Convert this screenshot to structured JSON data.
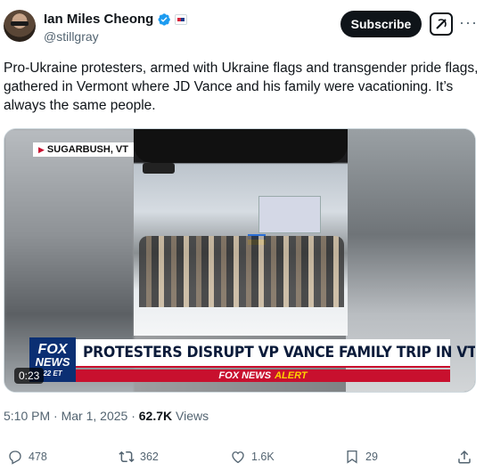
{
  "author": {
    "name": "Ian Miles Cheong",
    "handle": "@stillgray"
  },
  "header": {
    "subscribe_label": "Subscribe",
    "more_label": "···"
  },
  "tweet": {
    "text": "Pro-Ukraine protesters, armed with Ukraine flags and transgender pride flags, gathered in Vermont where JD Vance and his family were vacationing. It’s always the same people."
  },
  "video": {
    "location_label": "SUGARBUSH, VT",
    "logo_line1": "FOX",
    "logo_line2": "NEWS",
    "logo_time": "22 ET",
    "headline": "PROTESTERS DISRUPT VP VANCE FAMILY TRIP IN VT",
    "alert_brand": "FOX NEWS",
    "alert_word": "ALERT",
    "timecode": "0:23",
    "colors": {
      "fox_blue": "#0b2f73",
      "alert_red": "#c8102e",
      "alert_yellow": "#ffd200"
    }
  },
  "meta": {
    "time": "5:10 PM",
    "separator": "·",
    "date": "Mar 1, 2025",
    "views_count": "62.7K",
    "views_label": "Views"
  },
  "actions": {
    "replies": "478",
    "reposts": "362",
    "likes": "1.6K",
    "bookmarks": "29"
  }
}
